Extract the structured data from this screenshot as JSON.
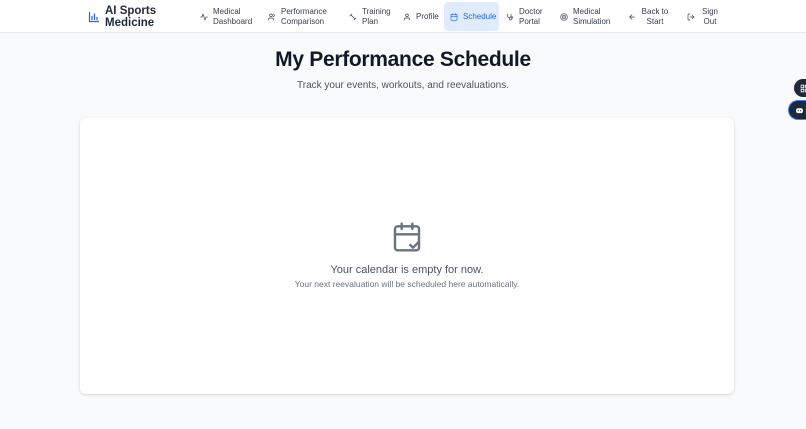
{
  "brand": {
    "name": "AI Sports Medicine",
    "icon": "bar-chart-icon"
  },
  "nav": [
    {
      "label": "Medical Dashboard",
      "icon": "activity-icon",
      "active": false
    },
    {
      "label": "Performance Comparison",
      "icon": "users-icon",
      "active": false
    },
    {
      "label": "Training Plan",
      "icon": "dumbbell-icon",
      "active": false
    },
    {
      "label": "Profile",
      "icon": "user-icon",
      "active": false
    },
    {
      "label": "Schedule",
      "icon": "calendar-icon",
      "active": true
    },
    {
      "label": "Doctor Portal",
      "icon": "stethoscope-icon",
      "active": false
    },
    {
      "label": "Medical Simulation",
      "icon": "target-icon",
      "active": false
    },
    {
      "label": "Back to Start",
      "icon": "arrow-left-icon",
      "active": false
    },
    {
      "label": "Sign Out",
      "icon": "log-out-icon",
      "active": false
    }
  ],
  "page": {
    "title": "My Performance Schedule",
    "subtitle": "Track your events, workouts, and reevaluations."
  },
  "empty_state": {
    "icon": "calendar-check-icon",
    "title": "Your calendar is empty for now.",
    "message": "Your next reevaluation will be scheduled here automatically."
  },
  "floating": {
    "button_a_icon": "grid-icon",
    "button_b_icon": "chat-bot-icon"
  },
  "colors": {
    "accent": "#2563eb",
    "active_bg": "#e0ecfd",
    "background": "#f9fafb"
  }
}
